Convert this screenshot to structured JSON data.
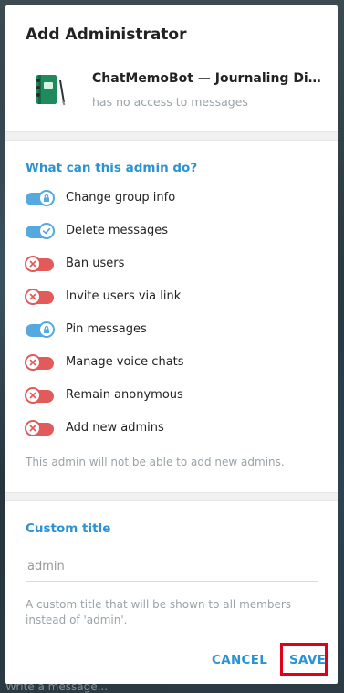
{
  "background": {
    "hint": "Write a message..."
  },
  "dialog": {
    "title": "Add Administrator",
    "bot": {
      "name": "ChatMemoBot — Journaling Diary",
      "status": "has no access to messages"
    },
    "permissions_header": "What can this admin do?",
    "permissions": [
      {
        "label": "Change group info",
        "enabled": true,
        "knob_icon": "lock-icon"
      },
      {
        "label": "Delete messages",
        "enabled": true,
        "knob_icon": "check-icon"
      },
      {
        "label": "Ban users",
        "enabled": false,
        "knob_icon": "x-icon"
      },
      {
        "label": "Invite users via link",
        "enabled": false,
        "knob_icon": "x-icon"
      },
      {
        "label": "Pin messages",
        "enabled": true,
        "knob_icon": "lock-icon"
      },
      {
        "label": "Manage voice chats",
        "enabled": false,
        "knob_icon": "x-icon"
      },
      {
        "label": "Remain anonymous",
        "enabled": false,
        "knob_icon": "x-icon"
      },
      {
        "label": "Add new admins",
        "enabled": false,
        "knob_icon": "x-icon"
      }
    ],
    "permissions_note": "This admin will not be able to add new admins.",
    "custom_title_header": "Custom title",
    "custom_title_placeholder": "admin",
    "custom_title_note": "A custom title that will be shown to all members instead of 'admin'.",
    "cancel_label": "CANCEL",
    "save_label": "SAVE",
    "colors": {
      "accent": "#2b93d3",
      "toggle_on": "#55a9de",
      "toggle_off": "#e35a5a",
      "highlight": "#e0001a"
    }
  }
}
